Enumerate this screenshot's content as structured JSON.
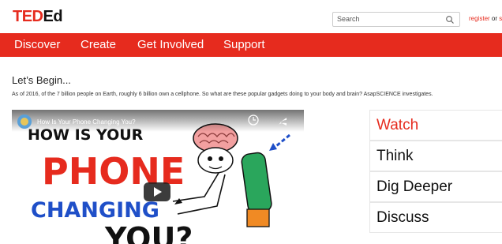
{
  "logo": {
    "ted": "TED",
    "ed": "Ed"
  },
  "search": {
    "placeholder": "Search"
  },
  "auth": {
    "register": "register",
    "or": "or",
    "signin": "si"
  },
  "nav": {
    "items": [
      "Discover",
      "Create",
      "Get Involved",
      "Support"
    ]
  },
  "lesson": {
    "heading": "Let’s Begin...",
    "description": "As of 2016, of the 7 billion people on Earth, roughly 6 billion own a cellphone. So what are these popular gadgets doing to your body and brain? AsapSCIENCE investigates."
  },
  "video": {
    "title": "How Is Your Phone Changing You?",
    "art_lines": [
      "HOW IS YOUR",
      "PHONE",
      "CHANGING",
      "YOU?"
    ]
  },
  "tabs": {
    "items": [
      "Watch",
      "Think",
      "Dig Deeper",
      "Discuss"
    ],
    "active": "Watch"
  },
  "colors": {
    "accent": "#e62b1e",
    "art_blue": "#1f4fc8",
    "art_green": "#2aa65c",
    "art_orange": "#f08a24"
  }
}
